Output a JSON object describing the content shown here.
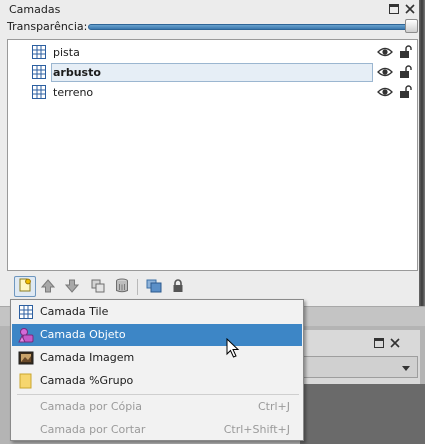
{
  "panel": {
    "title": "Camadas",
    "opacity_label": "Transparência:",
    "opacity_value": 1.0
  },
  "layers": [
    {
      "name": "pista",
      "type": "tile-layer",
      "visible": true,
      "locked": false,
      "selected": false
    },
    {
      "name": "arbusto",
      "type": "tile-layer",
      "visible": true,
      "locked": false,
      "selected": true
    },
    {
      "name": "terreno",
      "type": "tile-layer",
      "visible": true,
      "locked": false,
      "selected": false
    }
  ],
  "toolbar": {
    "buttons": [
      "new-layer",
      "raise-layer",
      "lower-layer",
      "duplicate-layer",
      "remove-layer",
      "show-hide-others",
      "lock-layer"
    ]
  },
  "menu": {
    "items": [
      {
        "label": "Camada Tile",
        "icon": "tile-layer-icon",
        "state": "normal"
      },
      {
        "label": "Camada Objeto",
        "icon": "object-layer-icon",
        "state": "active"
      },
      {
        "label": "Camada Imagem",
        "icon": "image-layer-icon",
        "state": "normal"
      },
      {
        "label": "Camada %Grupo",
        "icon": "group-layer-icon",
        "state": "normal"
      },
      {
        "label": "Camada por Cópia",
        "shortcut": "Ctrl+J",
        "state": "disabled"
      },
      {
        "label": "Camada por Cortar",
        "shortcut": "Ctrl+Shift+J",
        "state": "disabled"
      }
    ]
  },
  "colors": {
    "accent": "#3d86c6",
    "selection_bg": "#e6eef6"
  }
}
